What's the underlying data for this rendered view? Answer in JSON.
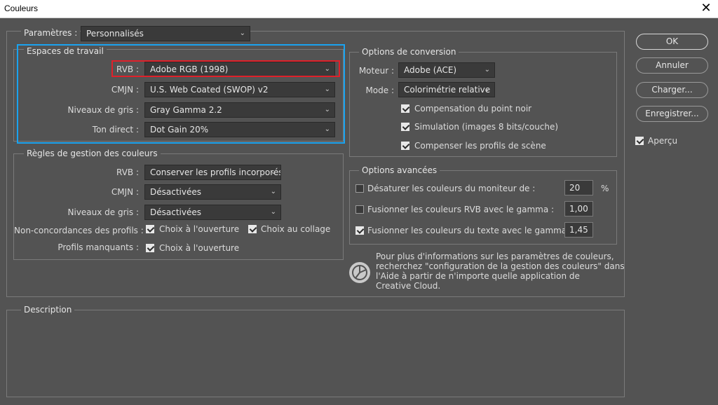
{
  "window": {
    "title": "Couleurs",
    "close_glyph": "✕"
  },
  "params": {
    "label": "Paramètres :",
    "value": "Personnalisés"
  },
  "workspaces": {
    "legend": "Espaces de travail",
    "rgb": {
      "label": "RVB :",
      "value": "Adobe RGB (1998)"
    },
    "cmyk": {
      "label": "CMJN :",
      "value": "U.S. Web Coated (SWOP) v2"
    },
    "gray": {
      "label": "Niveaux de gris :",
      "value": "Gray Gamma 2.2"
    },
    "spot": {
      "label": "Ton direct :",
      "value": "Dot Gain 20%"
    }
  },
  "management": {
    "legend": "Règles de gestion des couleurs",
    "rgb": {
      "label": "RVB :",
      "value": "Conserver les profils incorporés"
    },
    "cmyk": {
      "label": "CMJN :",
      "value": "Désactivées"
    },
    "gray": {
      "label": "Niveaux de gris :",
      "value": "Désactivées"
    },
    "mismatch": {
      "label": "Non-concordances des profils :",
      "open": "Choix à l'ouverture",
      "paste": "Choix au collage"
    },
    "missing": {
      "label": "Profils manquants :",
      "open": "Choix à l'ouverture"
    }
  },
  "conversion": {
    "legend": "Options de conversion",
    "engine": {
      "label": "Moteur :",
      "value": "Adobe (ACE)"
    },
    "mode": {
      "label": "Mode :",
      "value": "Colorimétrie relative"
    },
    "black_point": "Compensation du point noir",
    "dither": "Simulation (images 8 bits/couche)",
    "scene": "Compenser les profils de scène"
  },
  "advanced": {
    "legend": "Options avancées",
    "desaturate": {
      "label": "Désaturer les couleurs du moniteur de :",
      "value": "20",
      "unit": "%"
    },
    "blend_rgb": {
      "label": "Fusionner les couleurs RVB avec le gamma :",
      "value": "1,00"
    },
    "blend_text": {
      "label": "Fusionner les couleurs du texte avec le gamma :",
      "value": "1,45"
    }
  },
  "info": {
    "line1": "Pour plus d'informations sur les paramètres de couleurs,",
    "line2": "recherchez \"configuration de la gestion des couleurs\" dans",
    "line3": "l'Aide à partir de n'importe quelle application de",
    "line4": "Creative Cloud."
  },
  "description": {
    "legend": "Description"
  },
  "buttons": {
    "ok": "OK",
    "cancel": "Annuler",
    "load": "Charger...",
    "save": "Enregistrer...",
    "preview": "Aperçu"
  },
  "icons": {
    "dropdown": "chevron-down-icon",
    "check": "checkmark-icon",
    "info": "color-wheel-icon",
    "close": "close-icon"
  },
  "colors": {
    "background": "#535353",
    "highlight_blue": "#1aa3f0",
    "highlight_red": "#e0202a"
  }
}
